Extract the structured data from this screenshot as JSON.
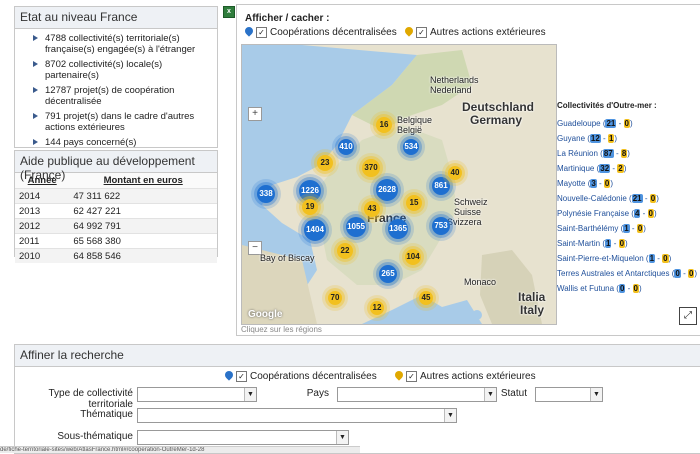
{
  "france": {
    "title": "Etat au niveau France",
    "stats": [
      "4788 collectivité(s) territoriale(s) française(s) engagée(s) à l'étranger",
      "8702 collectivité(s) locale(s) partenaire(s)",
      "12787 projet(s) de coopération décentralisée",
      "791 projet(s) dans le cadre d'autres actions extérieures",
      "144 pays concerné(s)"
    ]
  },
  "aid": {
    "title": "Aide publique au développement (France)",
    "col_year": "Année",
    "col_amount": "Montant en euros",
    "rows": [
      {
        "year": "2014",
        "amount": "47 311 622"
      },
      {
        "year": "2013",
        "amount": "62 427 221"
      },
      {
        "year": "2012",
        "amount": "64 992 791"
      },
      {
        "year": "2011",
        "amount": "65 568 380"
      },
      {
        "year": "2010",
        "amount": "64 858 546"
      }
    ]
  },
  "map_panel": {
    "toggle_title": "Afficher / cacher :",
    "toggle_blue": "Coopérations décentralisées",
    "toggle_gold": "Autres actions extérieures",
    "caption": "Cliquez sur les régions",
    "google": "Google",
    "labels": {
      "netherlands": "Netherlands",
      "nederland": "Nederland",
      "deutschland": "Deutschland",
      "germany": "Germany",
      "belgique": "Belgique",
      "belgie": "België",
      "france": "France",
      "schweiz": "Schweiz",
      "suisse": "Suisse",
      "svizzera": "Svizzera",
      "biscay": "Bay of Biscay",
      "monaco": "Monaco",
      "italia": "Italia",
      "italy": "Italy"
    },
    "clusters_blue": [
      "410",
      "534",
      "338",
      "1226",
      "2628",
      "861",
      "1404",
      "1055",
      "1365",
      "753",
      "265"
    ],
    "clusters_gold": [
      "16",
      "23",
      "370",
      "40",
      "19",
      "43",
      "15",
      "22",
      "104",
      "70",
      "12",
      "45"
    ]
  },
  "outremer": {
    "title": "Collectivités d'Outre-mer :",
    "items": [
      {
        "name": "Guadeloupe",
        "blue": "21",
        "gold": "0"
      },
      {
        "name": "Guyane",
        "blue": "12",
        "gold": "1"
      },
      {
        "name": "La Réunion",
        "blue": "87",
        "gold": "8"
      },
      {
        "name": "Martinique",
        "blue": "32",
        "gold": "2"
      },
      {
        "name": "Mayotte",
        "blue": "3",
        "gold": "0"
      },
      {
        "name": "Nouvelle-Calédonie",
        "blue": "21",
        "gold": "0"
      },
      {
        "name": "Polynésie Française",
        "blue": "4",
        "gold": "0"
      },
      {
        "name": "Saint-Barthélémy",
        "blue": "1",
        "gold": "0"
      },
      {
        "name": "Saint-Martin",
        "blue": "1",
        "gold": "0"
      },
      {
        "name": "Saint-Pierre-et-Miquelon",
        "blue": "1",
        "gold": "0"
      },
      {
        "name": "Terres Australes et Antarctiques",
        "blue": "0",
        "gold": "0"
      },
      {
        "name": "Wallis et Futuna",
        "blue": "0",
        "gold": "0"
      }
    ]
  },
  "refine": {
    "title": "Affiner la recherche",
    "toggle_blue": "Coopérations décentralisées",
    "toggle_gold": "Autres actions extérieures",
    "label_type": "Type de collectivité territoriale",
    "label_pays": "Pays",
    "label_statut": "Statut",
    "label_thematique": "Thématique",
    "label_sous": "Sous-thématique"
  },
  "status": "de/fiche-territoriale-sites/web/AtlasFrance.html#/cooperation-OutreMer-1d-28"
}
